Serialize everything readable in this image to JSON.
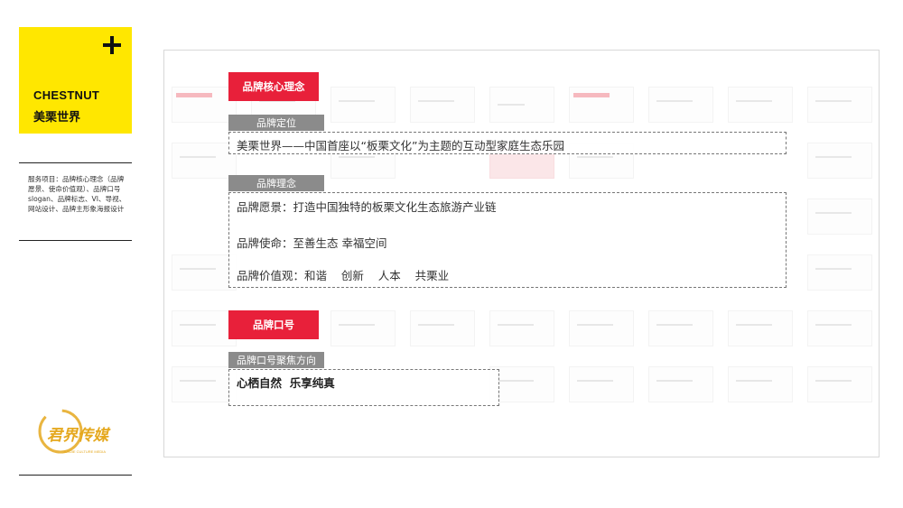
{
  "brand": {
    "name_en": "CHESTNUT",
    "name_cn": "美栗世界"
  },
  "services": {
    "text": "服务项目：品牌核心理念（品牌愿景、使命价值观）、品牌口号slogan、品牌标志、VI、导视、网站设计、品牌主形象海报设计"
  },
  "logo": {
    "label": "君界传媒",
    "sub_label": "JUNJIE CULTURE MEDIA",
    "color": "#E5A81E"
  },
  "core": {
    "heading": "品牌核心理念",
    "positioning": {
      "tab": "品牌定位",
      "text": "美栗世界——中国首座以“板栗文化”为主题的互动型家庭生态乐园"
    },
    "philosophy": {
      "tab": "品牌理念",
      "vision": "品牌愿景：打造中国独特的板栗文化生态旅游产业链",
      "mission": "品牌使命：至善生态  幸福空间",
      "values": "品牌价值观：和谐    创新    人本    共栗业"
    }
  },
  "slogan": {
    "heading": "品牌口号",
    "tab": "品牌口号聚焦方向",
    "text": "心栖自然  乐享纯真"
  },
  "colors": {
    "accent_red": "#E8203A",
    "brand_yellow": "#FFE700",
    "tab_gray": "#8B8B8B"
  }
}
